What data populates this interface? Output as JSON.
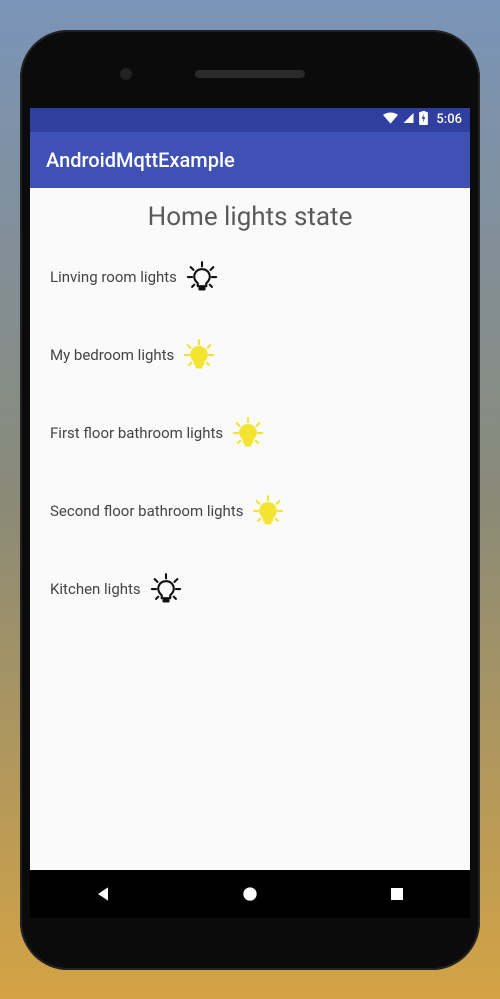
{
  "colors": {
    "primary": "#3f51b5",
    "primaryDark": "#303f9f",
    "bulbOn": "#f2e430",
    "bulbOff": "#111111"
  },
  "statusBar": {
    "time": "5:06"
  },
  "appBar": {
    "title": "AndroidMqttExample"
  },
  "page": {
    "title": "Home lights state"
  },
  "lights": [
    {
      "label": "Linving room lights",
      "on": false
    },
    {
      "label": "My bedroom lights",
      "on": true
    },
    {
      "label": "First floor bathroom lights",
      "on": true
    },
    {
      "label": "Second floor bathroom lights",
      "on": true
    },
    {
      "label": "Kitchen lights",
      "on": false
    }
  ]
}
